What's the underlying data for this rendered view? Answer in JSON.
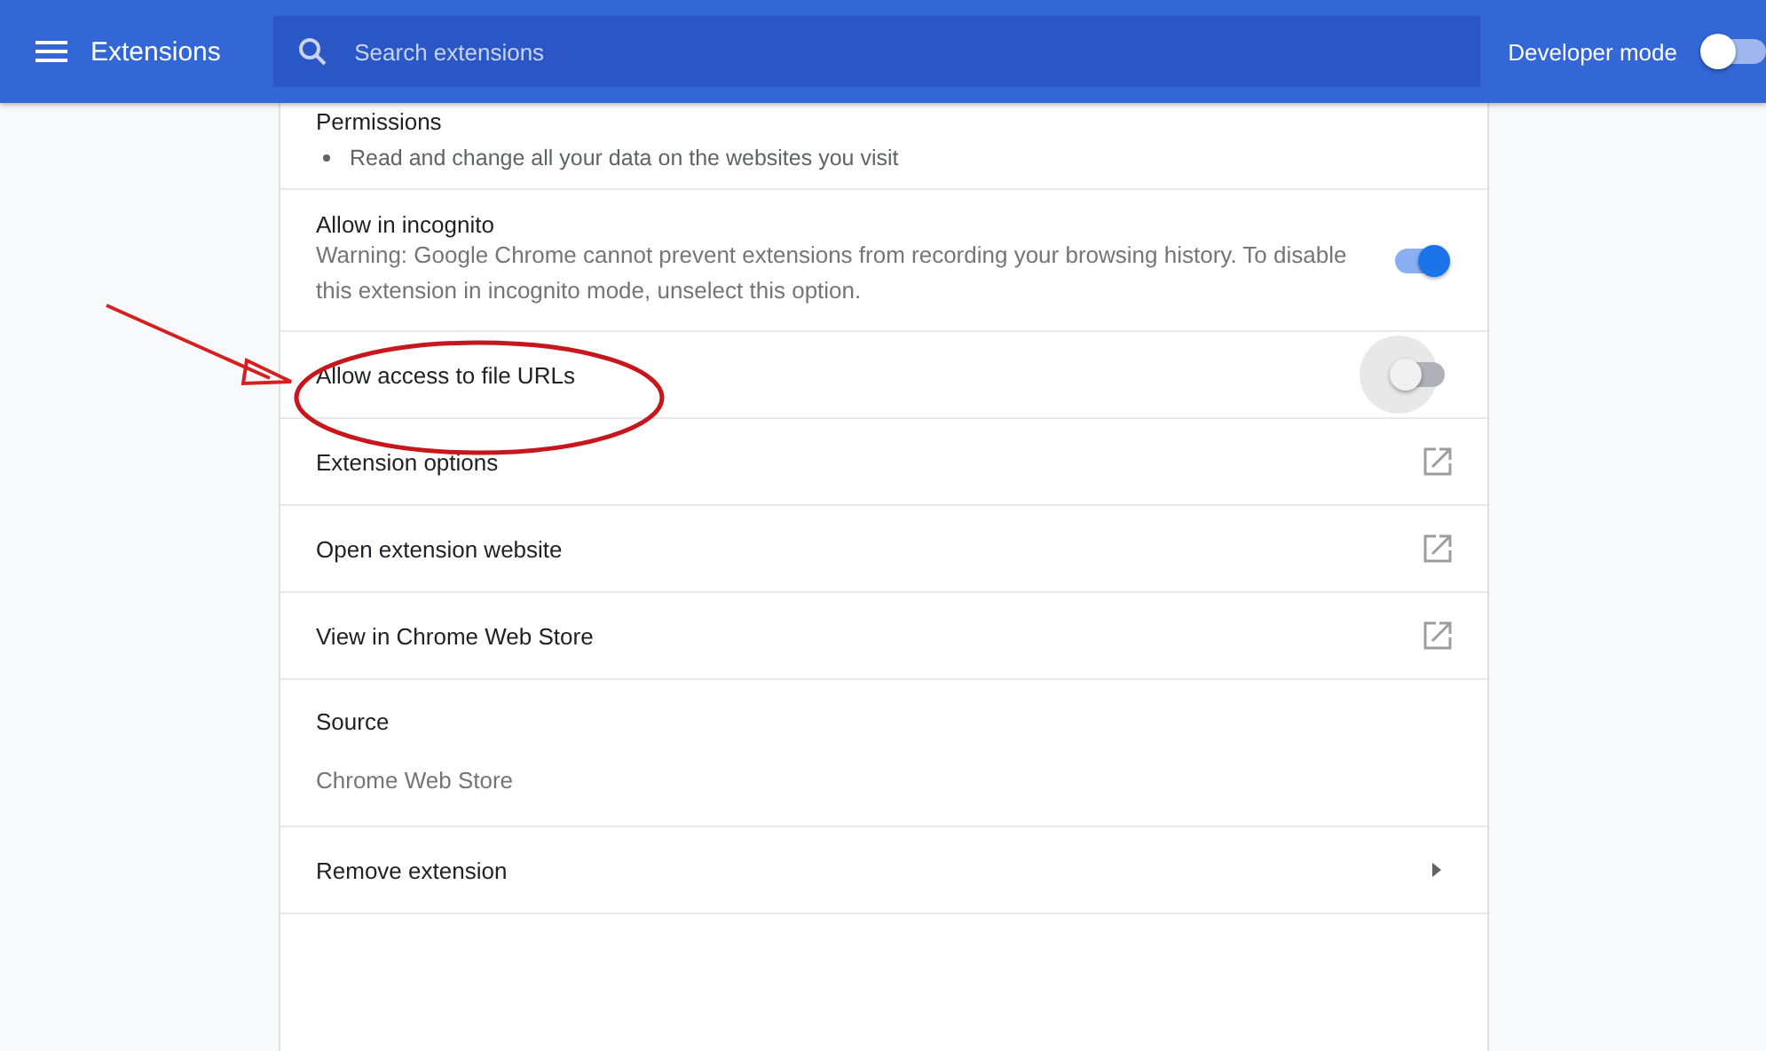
{
  "header": {
    "title": "Extensions",
    "search": {
      "placeholder": "Search extensions"
    },
    "developer_mode": {
      "label": "Developer mode",
      "on": false
    }
  },
  "permissions": {
    "heading": "Permissions",
    "items": [
      "Read and change all your data on the websites you visit"
    ]
  },
  "rows": [
    {
      "kind": "toggle",
      "label": "Allow in incognito",
      "description": "Warning: Google Chrome cannot prevent extensions from recording your browsing history. To disable this extension in incognito mode, unselect this option.",
      "on": true
    },
    {
      "kind": "toggle",
      "label": "Allow access to file URLs",
      "on": false,
      "focused": true
    },
    {
      "kind": "link",
      "label": "Extension options"
    },
    {
      "kind": "link",
      "label": "Open extension website"
    },
    {
      "kind": "link",
      "label": "View in Chrome Web Store"
    },
    {
      "kind": "info",
      "label": "Source",
      "value": "Chrome Web Store"
    },
    {
      "kind": "submenu",
      "label": "Remove extension"
    }
  ]
}
